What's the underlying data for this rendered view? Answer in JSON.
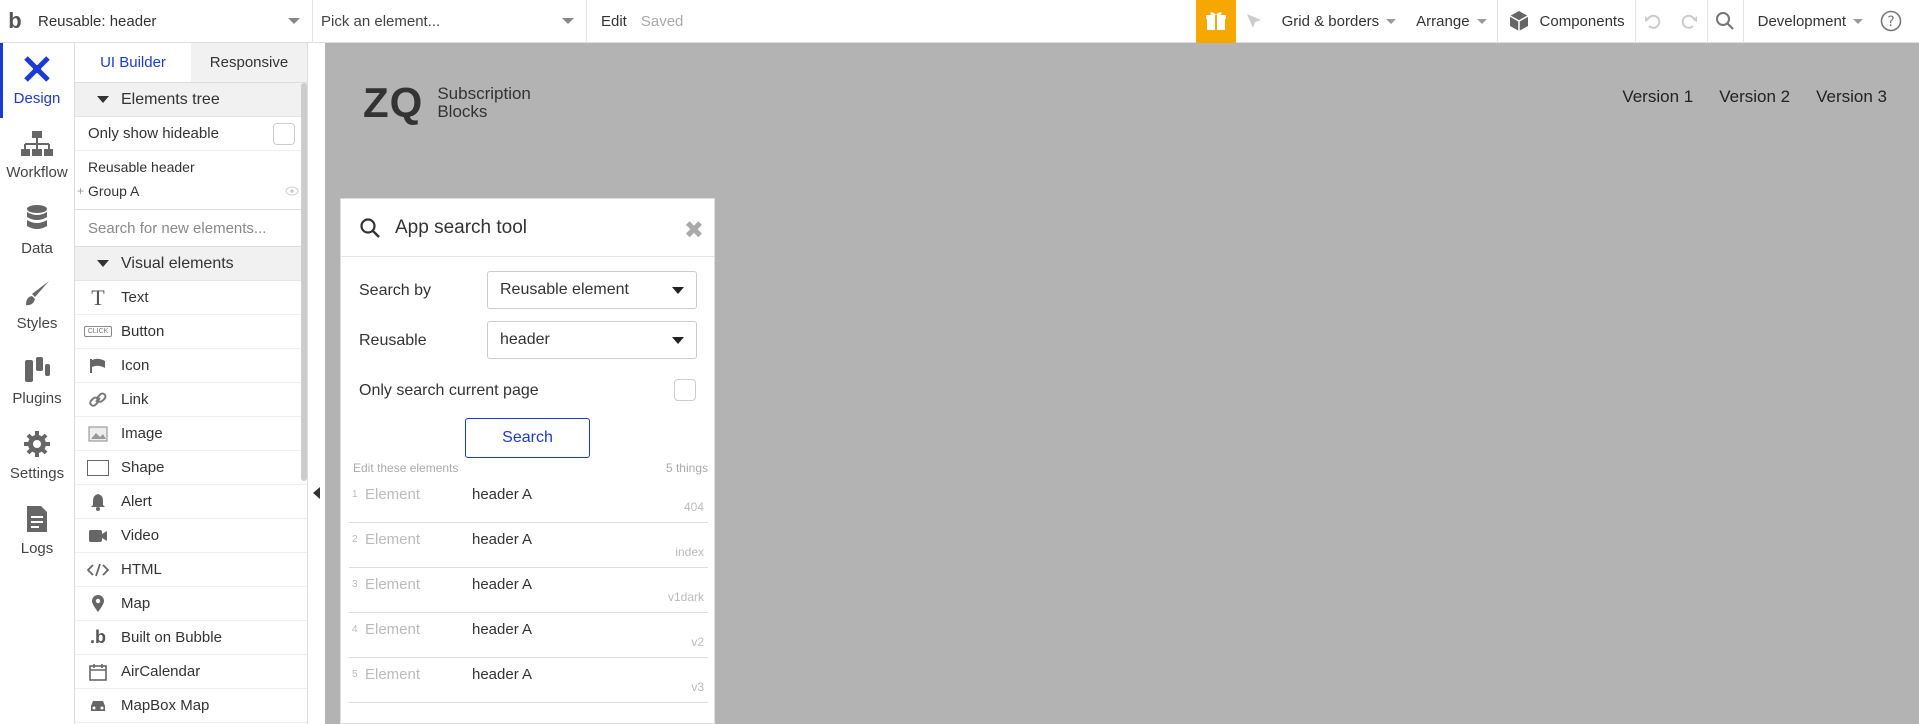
{
  "topbar": {
    "logo": "b",
    "page_select": "Reusable: header",
    "element_select": "Pick an element...",
    "edit": "Edit",
    "saved": "Saved",
    "grid": "Grid & borders",
    "arrange": "Arrange",
    "components": "Components",
    "environment": "Development"
  },
  "nav": [
    {
      "label": "Design",
      "icon": "design-icon"
    },
    {
      "label": "Workflow",
      "icon": "workflow-icon"
    },
    {
      "label": "Data",
      "icon": "data-icon"
    },
    {
      "label": "Styles",
      "icon": "styles-icon"
    },
    {
      "label": "Plugins",
      "icon": "plugins-icon"
    },
    {
      "label": "Settings",
      "icon": "settings-icon"
    },
    {
      "label": "Logs",
      "icon": "logs-icon"
    }
  ],
  "panel": {
    "tab_builder": "UI Builder",
    "tab_responsive": "Responsive",
    "elements_tree": "Elements tree",
    "only_hideable": "Only show hideable",
    "tree": [
      "Reusable header",
      "Group A"
    ],
    "search_placeholder": "Search for new elements...",
    "visual_elements": "Visual elements",
    "elements": [
      "Text",
      "Button",
      "Icon",
      "Link",
      "Image",
      "Shape",
      "Alert",
      "Video",
      "HTML",
      "Map",
      "Built on Bubble",
      "AirCalendar",
      "MapBox Map"
    ],
    "button_icon_text": "CLICK"
  },
  "canvas": {
    "brand_mark": "ZQ",
    "brand_line1": "Subscription",
    "brand_line2": "Blocks",
    "versions": [
      "Version 1",
      "Version 2",
      "Version 3"
    ]
  },
  "tool": {
    "title": "App search tool",
    "close": "✖",
    "search_by_label": "Search by",
    "search_by_value": "Reusable element",
    "reusable_label": "Reusable",
    "reusable_value": "header",
    "only_current_page": "Only search current page",
    "search_button": "Search",
    "results_caption": "Edit these elements",
    "results_count": "5 things",
    "results": [
      {
        "num": "1",
        "label": "Element",
        "value": "header A",
        "page": "404"
      },
      {
        "num": "2",
        "label": "Element",
        "value": "header A",
        "page": "index"
      },
      {
        "num": "3",
        "label": "Element",
        "value": "header A",
        "page": "v1dark"
      },
      {
        "num": "4",
        "label": "Element",
        "value": "header A",
        "page": "v2"
      },
      {
        "num": "5",
        "label": "Element",
        "value": "header A",
        "page": "v3"
      }
    ]
  },
  "colors": {
    "accent": "#1a3ad6",
    "gift": "#f6a800",
    "canvas": "#b3b3b3"
  }
}
